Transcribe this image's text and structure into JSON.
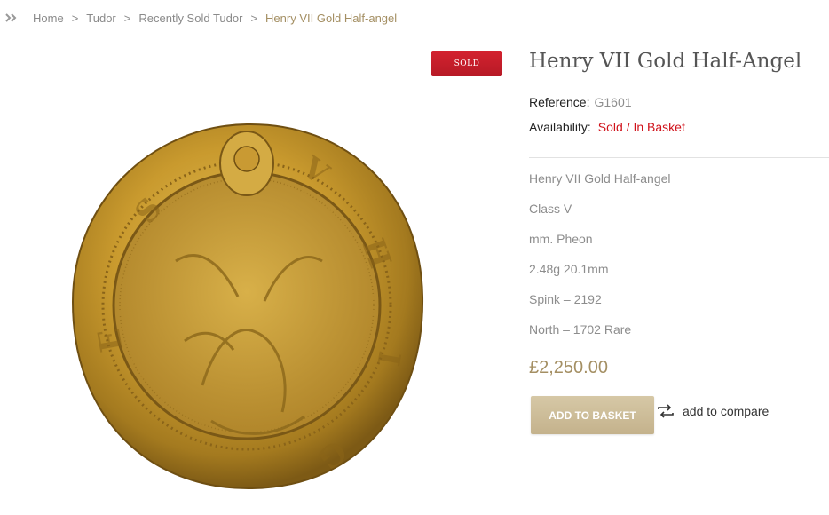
{
  "breadcrumb": {
    "icon": "double-chevron-right-icon",
    "items": [
      "Home",
      "Tudor",
      "Recently Sold Tudor"
    ],
    "separator": ">",
    "current": "Henry VII Gold Half-angel"
  },
  "product": {
    "badge": "SOLD",
    "title": "Henry VII Gold Half-Angel",
    "reference_label": "Reference:",
    "reference_value": "G1601",
    "availability_label": "Availability:",
    "availability_value": "Sold / In Basket",
    "description": [
      "Henry VII Gold Half-angel",
      "Class V",
      "mm. Pheon",
      "2.48g 20.1mm",
      "Spink – 2192",
      "North – 1702 Rare"
    ],
    "price": "£2,250.00",
    "add_to_basket": "ADD TO BASKET",
    "add_to_compare": "add to compare",
    "compare_icon": "compare-arrows-icon",
    "image_alt": "gold-coin-image"
  },
  "colors": {
    "accent_gold": "#a48f63",
    "sold_red": "#c81d29",
    "availability_red": "#d0121b",
    "button_tan": "#ccbb96"
  }
}
